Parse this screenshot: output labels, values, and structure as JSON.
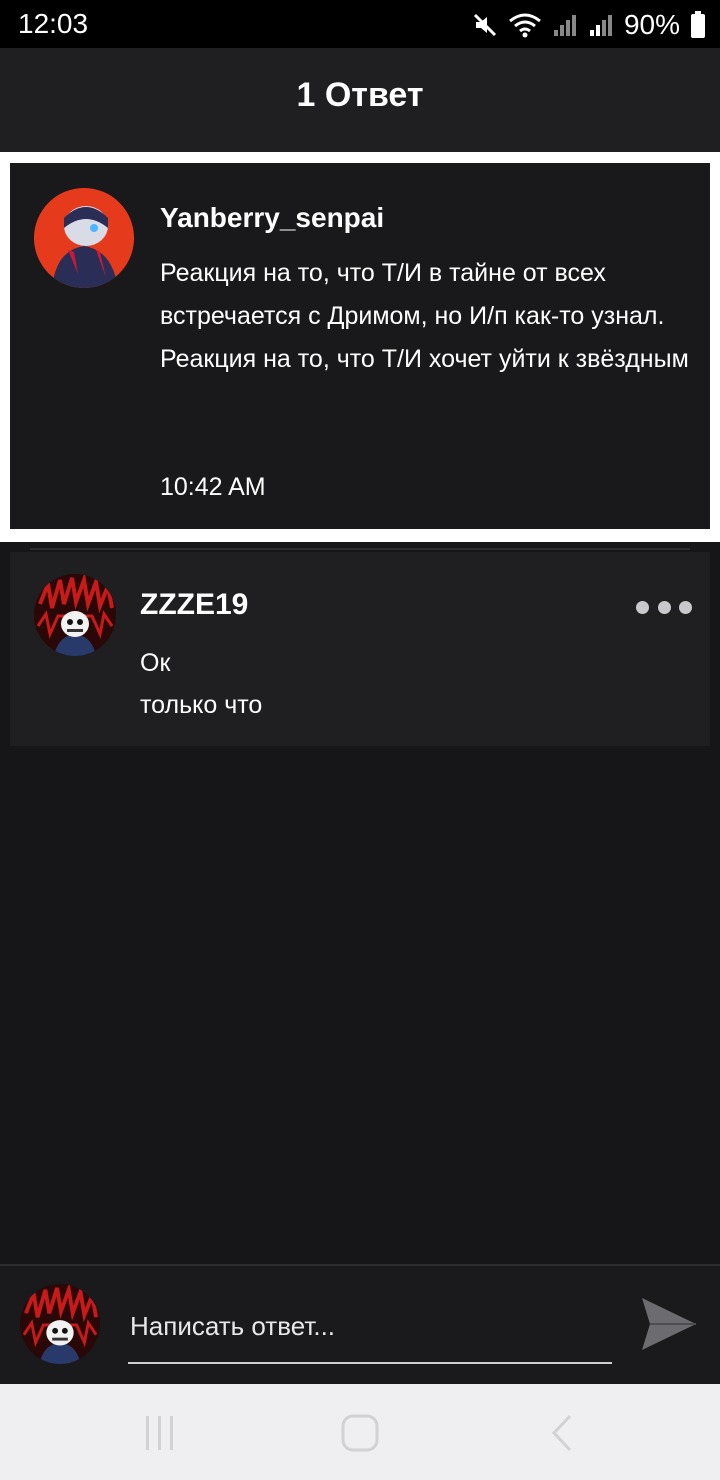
{
  "status": {
    "time": "12:03",
    "battery": "90%"
  },
  "header": {
    "title": "1 Ответ"
  },
  "post": {
    "author": "Yanberry_senpai",
    "text": "Реакция на то, что Т/И в тайне от всех встречается с Дримом, но И/п как-то узнал.\nРеакция на то, что Т/И хочет уйти к звёздным",
    "time": "10:42 AM"
  },
  "reply": {
    "author": "ZZZE19",
    "text": "Ок",
    "time": "только что"
  },
  "composer": {
    "placeholder": "Написать ответ..."
  },
  "icons": {
    "mute": "mute-icon",
    "wifi": "wifi-icon",
    "signal": "signal-icon",
    "battery": "battery-icon",
    "more": "more-dots-icon",
    "send": "send-icon",
    "recents": "recents-icon",
    "home": "home-icon",
    "back": "back-icon"
  }
}
